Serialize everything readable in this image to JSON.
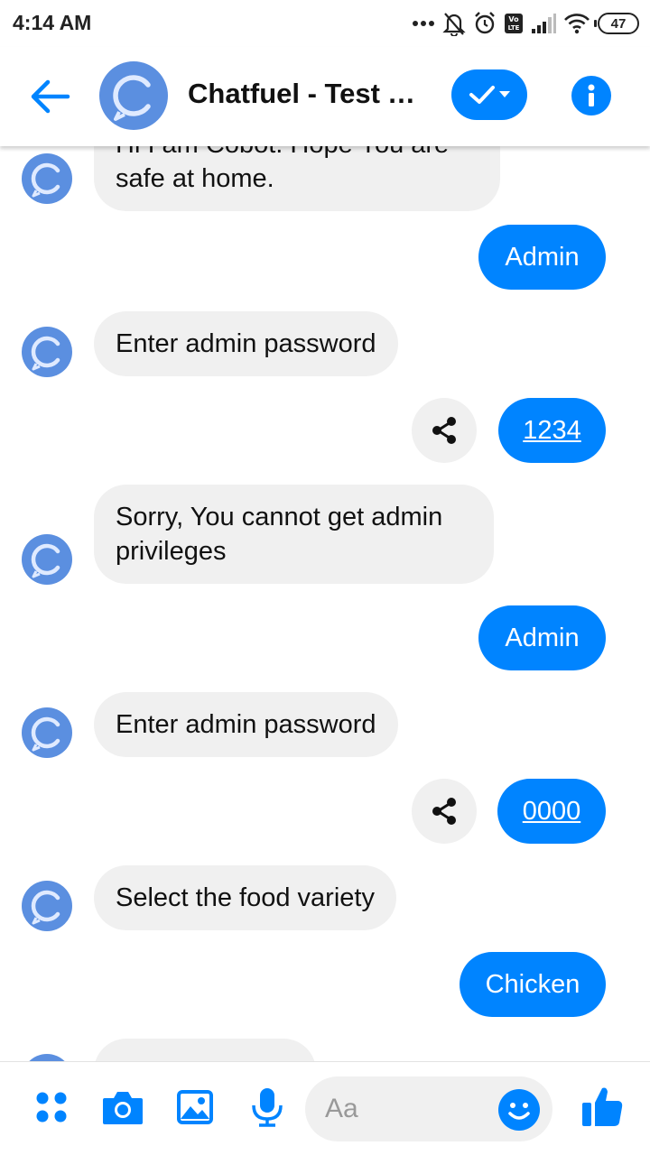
{
  "status_bar": {
    "time": "4:14 AM",
    "battery": "47"
  },
  "header": {
    "title": "Chatfuel - Test Y..."
  },
  "messages": {
    "bot_partial_line1": "Hi I am Cobot. Hope You are",
    "bot_partial_line2": "safe at home.",
    "user_1": "Admin",
    "bot_1": "Enter admin password",
    "user_2": "1234",
    "bot_2_line1": "Sorry, You cannot get admin",
    "bot_2_line2": "privileges",
    "user_3": "Admin",
    "bot_3": "Enter admin password",
    "user_4": "0000",
    "bot_4": "Select the food variety",
    "user_5": "Chicken"
  },
  "composer": {
    "placeholder": "Aa"
  },
  "colors": {
    "accent": "#0084ff",
    "bot_bubble": "#f0f0f0",
    "avatar": "#5b8fe0"
  },
  "icons": [
    "back-arrow-icon",
    "chatfuel-logo-icon",
    "check-icon",
    "chevron-down-icon",
    "info-icon",
    "share-icon",
    "apps-icon",
    "camera-icon",
    "image-icon",
    "microphone-icon",
    "emoji-icon",
    "thumbs-up-icon"
  ]
}
